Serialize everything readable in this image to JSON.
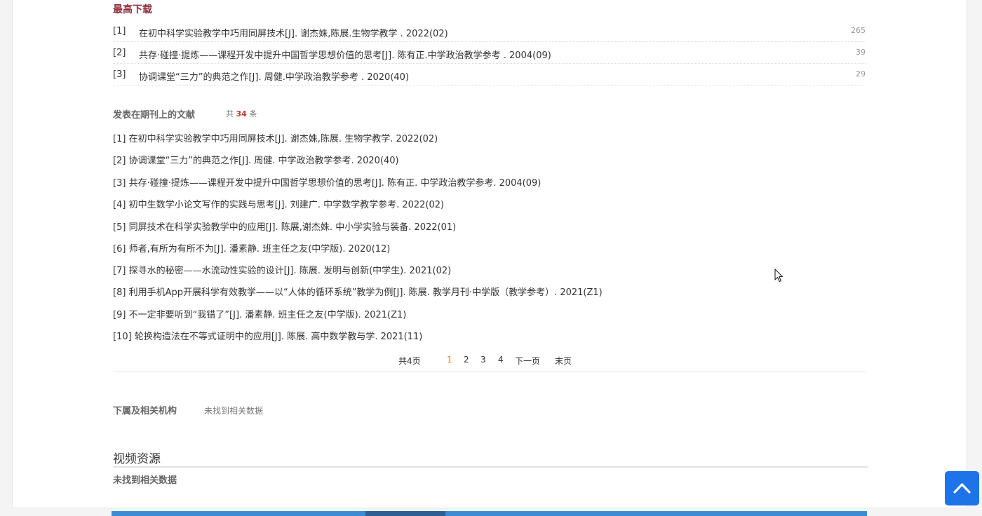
{
  "top_downloads": {
    "title": "最高下载",
    "items": [
      {
        "index": "[1]",
        "title": "在初中科学实验教学中巧用同屏技术[J]. 谢杰姝,陈展.生物学教学 . 2022(02)",
        "count": "265"
      },
      {
        "index": "[2]",
        "title": "共存·碰撞·提炼——课程开发中提升中国哲学思想价值的思考[J]. 陈有正.中学政治教学参考 . 2004(09)",
        "count": "39"
      },
      {
        "index": "[3]",
        "title": "协调课堂“三力”的典范之作[J]. 周健.中学政治教学参考 . 2020(40)",
        "count": "29"
      }
    ]
  },
  "journal_pubs": {
    "title": "发表在期刊上的文献",
    "total_prefix": "共",
    "total_count": "34",
    "total_suffix": "条",
    "items": [
      {
        "index": "[1]",
        "title": "在初中科学实验教学中巧用同屏技术[J]. 谢杰姝,陈展.  生物学教学. 2022(02)"
      },
      {
        "index": "[2]",
        "title": "协调课堂“三力”的典范之作[J]. 周健.  中学政治教学参考. 2020(40)"
      },
      {
        "index": "[3]",
        "title": "共存·碰撞·提炼——课程开发中提升中国哲学思想价值的思考[J]. 陈有正.  中学政治教学参考. 2004(09)"
      },
      {
        "index": "[4]",
        "title": "初中生数学小论文写作的实践与思考[J]. 刘建广.  中学数学教学参考. 2022(02)"
      },
      {
        "index": "[5]",
        "title": "同屏技术在科学实验教学中的应用[J]. 陈展,谢杰姝.  中小学实验与装备. 2022(01)"
      },
      {
        "index": "[6]",
        "title": "师者,有所为有所不为[J]. 潘素静.  班主任之友(中学版). 2020(12)"
      },
      {
        "index": "[7]",
        "title": "探寻水的秘密——水流动性实验的设计[J]. 陈展.  发明与创新(中学生). 2021(02)"
      },
      {
        "index": "[8]",
        "title": "利用手机App开展科学有效教学——以“人体的循环系统”教学为例[J]. 陈展.  教学月刊·中学版（教学参考）. 2021(Z1)"
      },
      {
        "index": "[9]",
        "title": "不一定非要听到“我错了”[J]. 潘素静.  班主任之友(中学版). 2021(Z1)"
      },
      {
        "index": "[10]",
        "title": "轮换构造法在不等式证明中的应用[J]. 陈展.  高中数学教与学. 2021(11)"
      }
    ]
  },
  "pager": {
    "total_pages": "共4页",
    "pages": [
      "1",
      "2",
      "3",
      "4"
    ],
    "current": "1",
    "next": "下一页",
    "last": "末页"
  },
  "org": {
    "title": "下属及相关机构",
    "no_data": "未找到相关数据"
  },
  "video": {
    "title": "视频资源",
    "no_data": "未找到相关数据"
  },
  "colors": {
    "accent_red": "#8c2f3d",
    "count_red": "#c0392b",
    "pager_current": "#e67e22",
    "back_top": "#1e73e8"
  },
  "icons": {
    "back_to_top": "chevron-up-icon",
    "cursor": "mouse-pointer-icon"
  }
}
